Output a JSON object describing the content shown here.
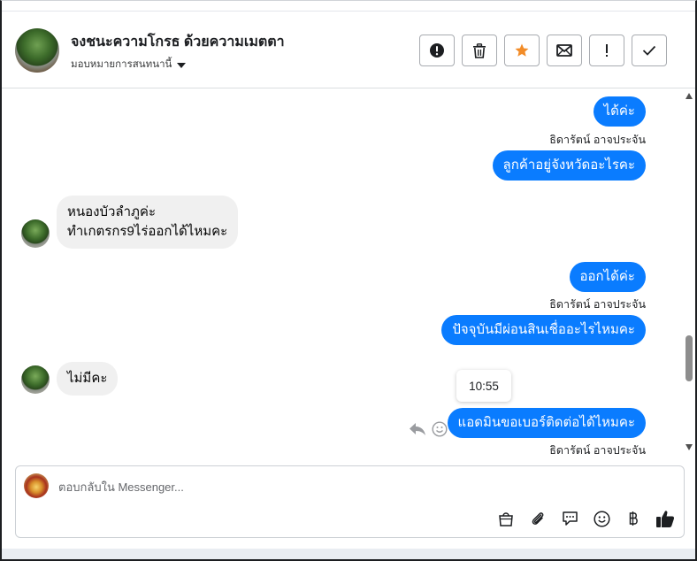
{
  "header": {
    "title": "จงชนะความโกรธ ด้วยความเมตตา",
    "assign_label": "มอบหมายการสนทนานี้",
    "toolbar": [
      {
        "name": "spam-button",
        "icon": "exclamation-circle-icon",
        "glyph": "!"
      },
      {
        "name": "delete-button",
        "icon": "trash-icon",
        "glyph": ""
      },
      {
        "name": "star-button",
        "icon": "star-icon",
        "glyph": "★"
      },
      {
        "name": "mark-unread-button",
        "icon": "envelope-icon",
        "glyph": ""
      },
      {
        "name": "follow-up-button",
        "icon": "exclamation-icon",
        "glyph": "!"
      },
      {
        "name": "mark-done-button",
        "icon": "check-icon",
        "glyph": "✓"
      }
    ]
  },
  "messages": {
    "m1": "ได้ค่ะ",
    "m1_sender": "ธิดารัตน์ อาจประจัน",
    "m2": "ลูกค้าอยู่จังหวัดอะไรคะ",
    "m3_line1": "หนองบัวลำภูค่ะ",
    "m3_line2": "ทำเกตรกร9ไร่ออกได้ไหมคะ",
    "m4": "ออกได้ค่ะ",
    "m4_sender": "ธิดารัตน์ อาจประจัน",
    "m5": "ปัจจุบันมีผ่อนสินเชื่ออะไรไหมคะ",
    "m6": "ไม่มีคะ",
    "m7": "แอดมินขอเบอร์ติดต่อได้ไหมคะ",
    "m7_sender": "ธิดารัตน์ อาจประจัน",
    "tooltip_time": "10:55"
  },
  "composer": {
    "placeholder": "ตอบกลับใน Messenger..."
  },
  "colors": {
    "outgoing_bubble": "#0a7cff",
    "incoming_bubble": "#f0f0f0",
    "star_accent": "#f28c28"
  }
}
